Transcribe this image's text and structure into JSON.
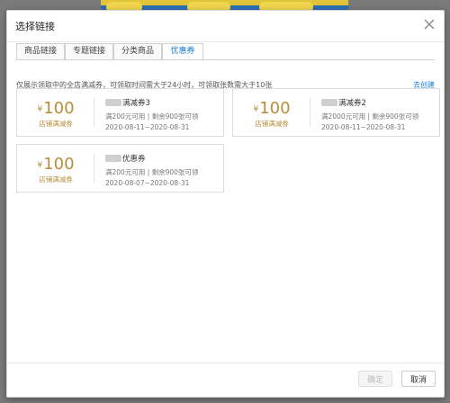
{
  "dialog": {
    "title": "选择链接"
  },
  "tabs": [
    {
      "label": "商品链接",
      "active": false
    },
    {
      "label": "专题链接",
      "active": false
    },
    {
      "label": "分类商品",
      "active": false
    },
    {
      "label": "优惠券",
      "active": true
    }
  ],
  "hint": "仅展示领取中的全店满减券，可领取时间需大于24小时，可领取张数需大于10张",
  "create_link": "去创建",
  "coupons": [
    {
      "currency": "¥",
      "amount": "100",
      "type": "店铺满减券",
      "name": "满减券3",
      "condition": "满200元可用 | 剩余900张可领",
      "date_range": "2020-08-11~2020-08-31"
    },
    {
      "currency": "¥",
      "amount": "100",
      "type": "店铺满减券",
      "name": "满减券2",
      "condition": "满2000元可用 | 剩余900张可领",
      "date_range": "2020-08-11~2020-08-31"
    },
    {
      "currency": "¥",
      "amount": "100",
      "type": "店铺满减券",
      "name": "优惠券",
      "condition": "满200元可用 | 剩余900张可领",
      "date_range": "2020-08-07~2020-08-31"
    }
  ],
  "footer": {
    "confirm_label": "确定",
    "cancel_label": "取消"
  },
  "colors": {
    "accent": "#1e7fd6",
    "coupon_gold": "#b58f3c"
  }
}
